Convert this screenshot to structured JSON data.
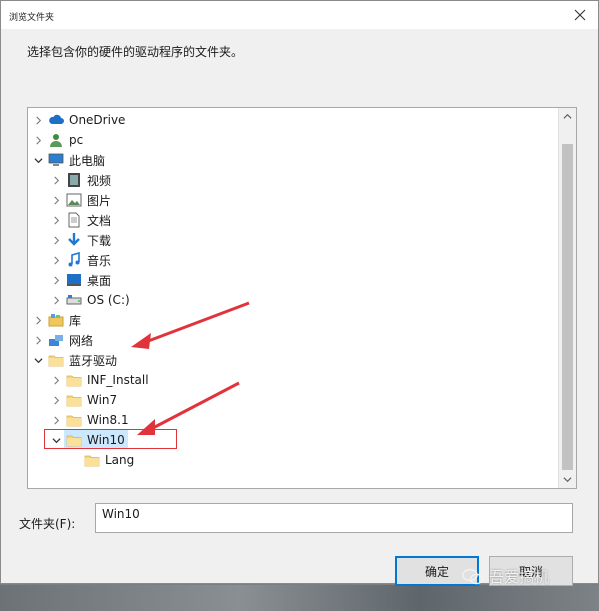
{
  "window": {
    "title": "浏览文件夹"
  },
  "prompt": "选择包含你的硬件的驱动程序的文件夹。",
  "tree": [
    {
      "label": "OneDrive",
      "icon": "cloud-icon",
      "expanded": false,
      "depth": 0
    },
    {
      "label": "pc",
      "icon": "user-icon",
      "expanded": false,
      "depth": 0
    },
    {
      "label": "此电脑",
      "icon": "computer-icon",
      "expanded": true,
      "depth": 0
    },
    {
      "label": "视频",
      "icon": "video-icon",
      "expanded": false,
      "depth": 1
    },
    {
      "label": "图片",
      "icon": "picture-icon",
      "expanded": false,
      "depth": 1
    },
    {
      "label": "文档",
      "icon": "document-icon",
      "expanded": false,
      "depth": 1
    },
    {
      "label": "下载",
      "icon": "download-icon",
      "expanded": false,
      "depth": 1
    },
    {
      "label": "音乐",
      "icon": "music-icon",
      "expanded": false,
      "depth": 1
    },
    {
      "label": "桌面",
      "icon": "desktop-icon",
      "expanded": false,
      "depth": 1
    },
    {
      "label": "OS (C:)",
      "icon": "drive-icon",
      "expanded": false,
      "depth": 1
    },
    {
      "label": "库",
      "icon": "library-icon",
      "expanded": false,
      "depth": 0
    },
    {
      "label": "网络",
      "icon": "network-icon",
      "expanded": false,
      "depth": 0
    },
    {
      "label": "蓝牙驱动",
      "icon": "folder-icon",
      "expanded": true,
      "depth": 0
    },
    {
      "label": "INF_Install",
      "icon": "folder-icon",
      "expanded": false,
      "depth": 1
    },
    {
      "label": "Win7",
      "icon": "folder-icon",
      "expanded": false,
      "depth": 1
    },
    {
      "label": "Win8.1",
      "icon": "folder-icon",
      "expanded": false,
      "depth": 1
    },
    {
      "label": "Win10",
      "icon": "folder-icon",
      "expanded": true,
      "depth": 1,
      "selected": true
    },
    {
      "label": "Lang",
      "icon": "folder-icon",
      "expanded": null,
      "depth": 2
    }
  ],
  "folder_field": {
    "label": "文件夹(F):",
    "value": "Win10"
  },
  "buttons": {
    "ok": "确定",
    "cancel": "取消"
  },
  "watermark": "吾爱搞机",
  "colors": {
    "accent": "#0078d7",
    "selection": "#cce8ff",
    "annotation": "#e0333b"
  }
}
